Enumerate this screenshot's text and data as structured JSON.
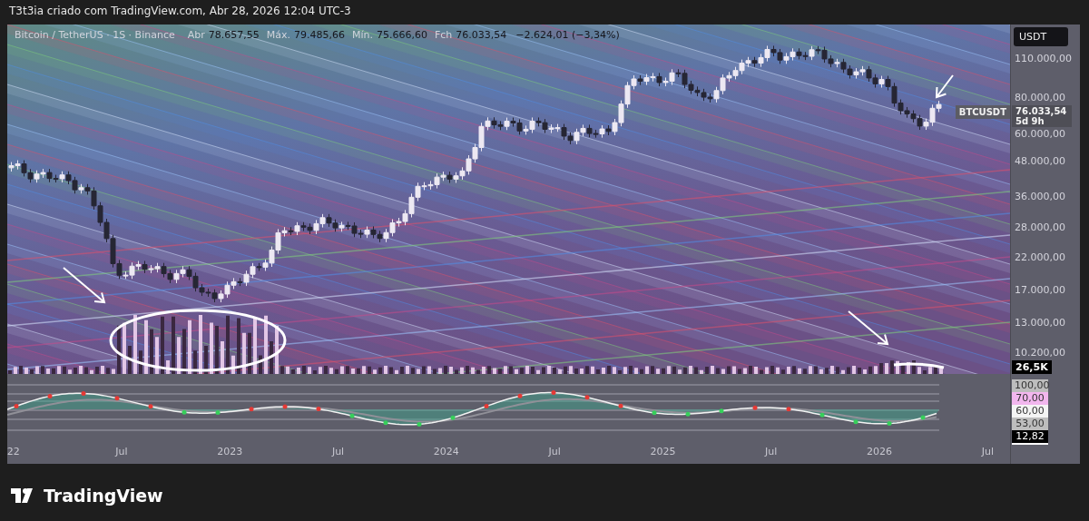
{
  "header": {
    "title": "T3t3ia criado com TradingView.com, Abr 28, 2026 12:04 UTC-3"
  },
  "legend": {
    "symbol": "Bitcoin / TetherUS · 1S · Binance",
    "values": [
      {
        "label": "Abr",
        "value": "78.657,55"
      },
      {
        "label": "Máx.",
        "value": "79.485,66"
      },
      {
        "label": "Mín.",
        "value": "75.666,60"
      },
      {
        "label": "Fch",
        "value": "76.033,54"
      }
    ],
    "change": "−2.624,01 (−3,34%)"
  },
  "price_axis": {
    "currency": "USDT",
    "ticks": [
      "110.000,00",
      "80.000,00",
      "60.000,00",
      "48.000,00",
      "36.000,00",
      "28.000,00",
      "22.000,00",
      "17.000,00",
      "13.000,00",
      "10.200,00"
    ]
  },
  "last_price": {
    "symbol": "BTCUSDT",
    "price": "76.033,54",
    "countdown": "5d 9h"
  },
  "volume_label": "26,5K",
  "oscillator_axis": {
    "ticks": [
      {
        "text": "100,00",
        "kind": "grey"
      },
      {
        "text": "70,00",
        "kind": "pink"
      },
      {
        "text": "60,00",
        "kind": "white"
      },
      {
        "text": "53,00",
        "kind": "grey"
      },
      {
        "text": "12,82",
        "kind": "dark"
      }
    ]
  },
  "time_axis": [
    "22",
    "Jul",
    "2023",
    "Jul",
    "2024",
    "Jul",
    "2025",
    "Jul",
    "2026",
    "Jul"
  ],
  "footer": {
    "brand": "TradingView"
  }
}
